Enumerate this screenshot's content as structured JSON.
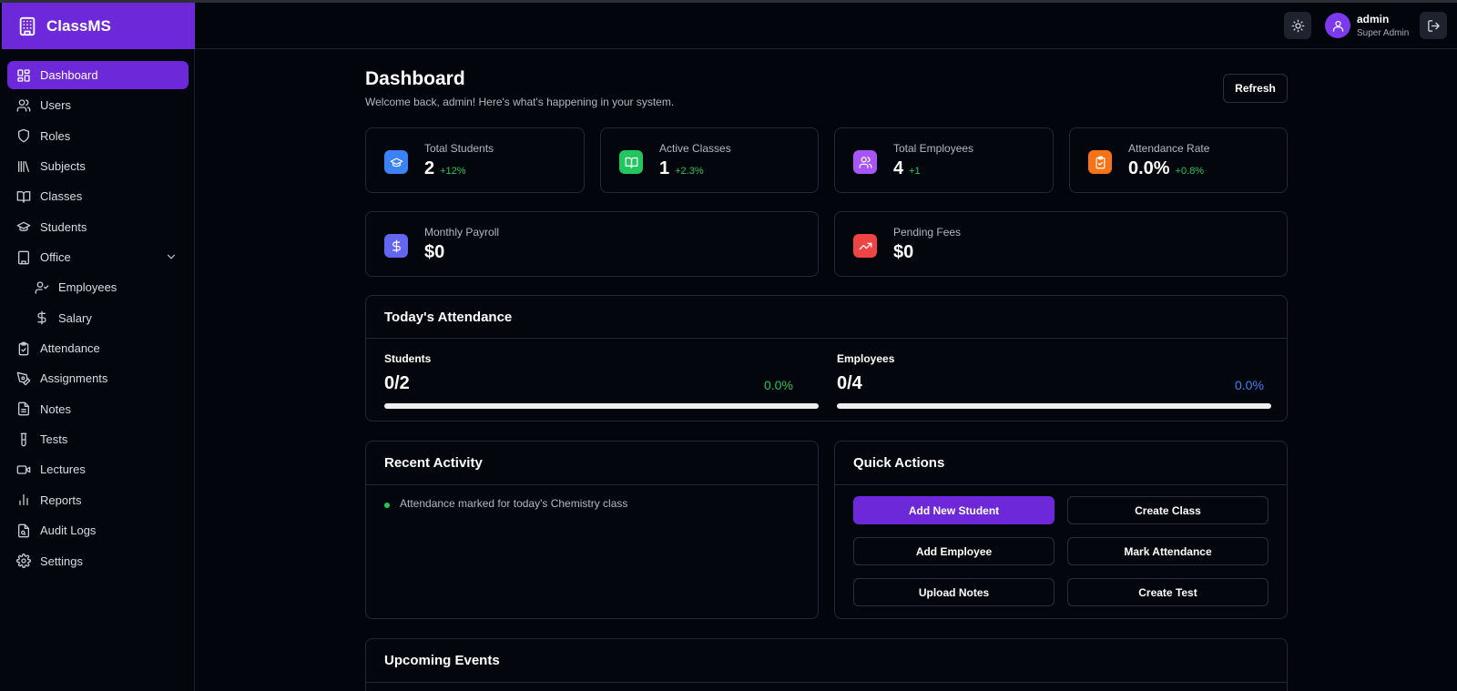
{
  "app": {
    "name": "ClassMS"
  },
  "header": {
    "user_name": "admin",
    "user_role": "Super Admin"
  },
  "sidebar": {
    "items": [
      {
        "label": "Dashboard",
        "icon": "dashboard-icon"
      },
      {
        "label": "Users",
        "icon": "users-icon"
      },
      {
        "label": "Roles",
        "icon": "shield-icon"
      },
      {
        "label": "Subjects",
        "icon": "library-icon"
      },
      {
        "label": "Classes",
        "icon": "book-open-icon"
      },
      {
        "label": "Students",
        "icon": "graduation-cap-icon"
      },
      {
        "label": "Office",
        "icon": "building-icon"
      },
      {
        "label": "Employees",
        "icon": "user-check-icon"
      },
      {
        "label": "Salary",
        "icon": "dollar-icon"
      },
      {
        "label": "Attendance",
        "icon": "clipboard-check-icon"
      },
      {
        "label": "Assignments",
        "icon": "pen-tool-icon"
      },
      {
        "label": "Notes",
        "icon": "file-text-icon"
      },
      {
        "label": "Tests",
        "icon": "test-tube-icon"
      },
      {
        "label": "Lectures",
        "icon": "video-icon"
      },
      {
        "label": "Reports",
        "icon": "bar-chart-icon"
      },
      {
        "label": "Audit Logs",
        "icon": "file-search-icon"
      },
      {
        "label": "Settings",
        "icon": "gear-icon"
      }
    ]
  },
  "main": {
    "title": "Dashboard",
    "subtitle": "Welcome back, admin! Here's what's happening in your system.",
    "refresh_label": "Refresh",
    "stats": [
      {
        "label": "Total Students",
        "value": "2",
        "delta": "+12%",
        "color": "#3b82f6",
        "icon": "graduation-cap-icon"
      },
      {
        "label": "Active Classes",
        "value": "1",
        "delta": "+2.3%",
        "color": "#22c55e",
        "icon": "book-open-icon"
      },
      {
        "label": "Total Employees",
        "value": "4",
        "delta": "+1",
        "color": "#a855f7",
        "icon": "users-icon"
      },
      {
        "label": "Attendance Rate",
        "value": "0.0%",
        "delta": "+0.8%",
        "color": "#f97316",
        "icon": "clipboard-check-icon"
      }
    ],
    "finance": [
      {
        "label": "Monthly Payroll",
        "value": "$0",
        "color": "#6366f1",
        "icon": "dollar-icon"
      },
      {
        "label": "Pending Fees",
        "value": "$0",
        "color": "#ef4444",
        "icon": "trending-up-icon"
      }
    ],
    "attendance": {
      "title": "Today's Attendance",
      "students": {
        "label": "Students",
        "count": "0/2",
        "percent": "0.0%",
        "fill": 0.0,
        "color": "#22c55e"
      },
      "employees": {
        "label": "Employees",
        "count": "0/4",
        "percent": "0.0%",
        "fill": 0.0,
        "color": "#3b82f6"
      }
    },
    "recent_activity": {
      "title": "Recent Activity",
      "items": [
        "Attendance marked for today's Chemistry class"
      ]
    },
    "quick_actions": {
      "title": "Quick Actions",
      "buttons": [
        "Add New Student",
        "Create Class",
        "Add Employee",
        "Mark Attendance",
        "Upload Notes",
        "Create Test"
      ]
    },
    "upcoming_events": {
      "title": "Upcoming Events"
    }
  }
}
